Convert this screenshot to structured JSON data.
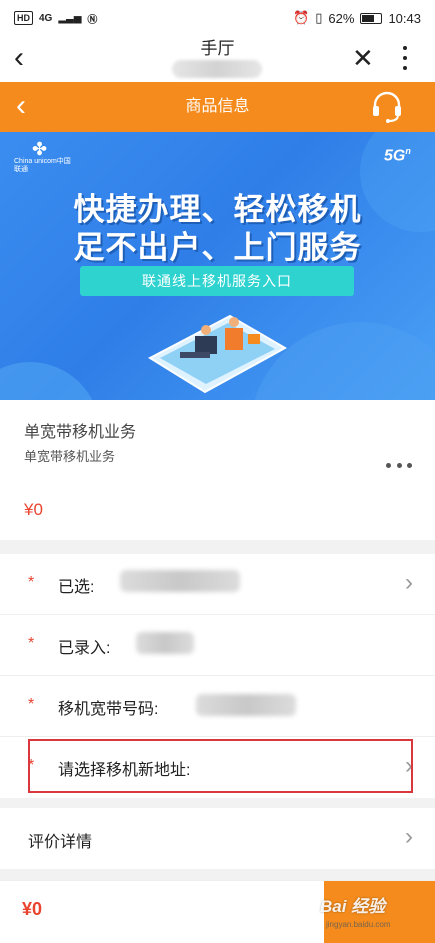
{
  "status_bar": {
    "hd": "HD",
    "network": "4G",
    "battery": "62%",
    "time": "10:43"
  },
  "browser": {
    "back_icon": "‹",
    "title": "手厅",
    "close_icon": "✕"
  },
  "header": {
    "back_icon": "‹",
    "title": "商品信息",
    "service_icon": "headset-icon"
  },
  "banner": {
    "logo_text": "China unicom中国联通",
    "badge": "5G",
    "badge_sup": "n",
    "line1": "快捷办理、轻松移机",
    "line2": "足不出户、上门服务",
    "pill": "联通线上移机服务入口"
  },
  "product": {
    "name": "单宽带移机业务",
    "subtitle": "单宽带移机业务",
    "price": "¥0"
  },
  "form": {
    "rows": [
      {
        "required": "*",
        "label": "已选:"
      },
      {
        "required": "*",
        "label": "已录入:"
      },
      {
        "required": "*",
        "label": "移机宽带号码:"
      },
      {
        "required": "*",
        "label": "请选择移机新地址:"
      }
    ]
  },
  "review": {
    "label": "评价详情"
  },
  "footer": {
    "price": "¥0",
    "watermark": "Bai 经验",
    "watermark_url": "jingyan.baidu.com"
  },
  "colors": {
    "brand_orange": "#f48b1c",
    "price_red": "#e8442f",
    "banner_blue": "#2f7ee8",
    "highlight_red": "#d9363e"
  }
}
